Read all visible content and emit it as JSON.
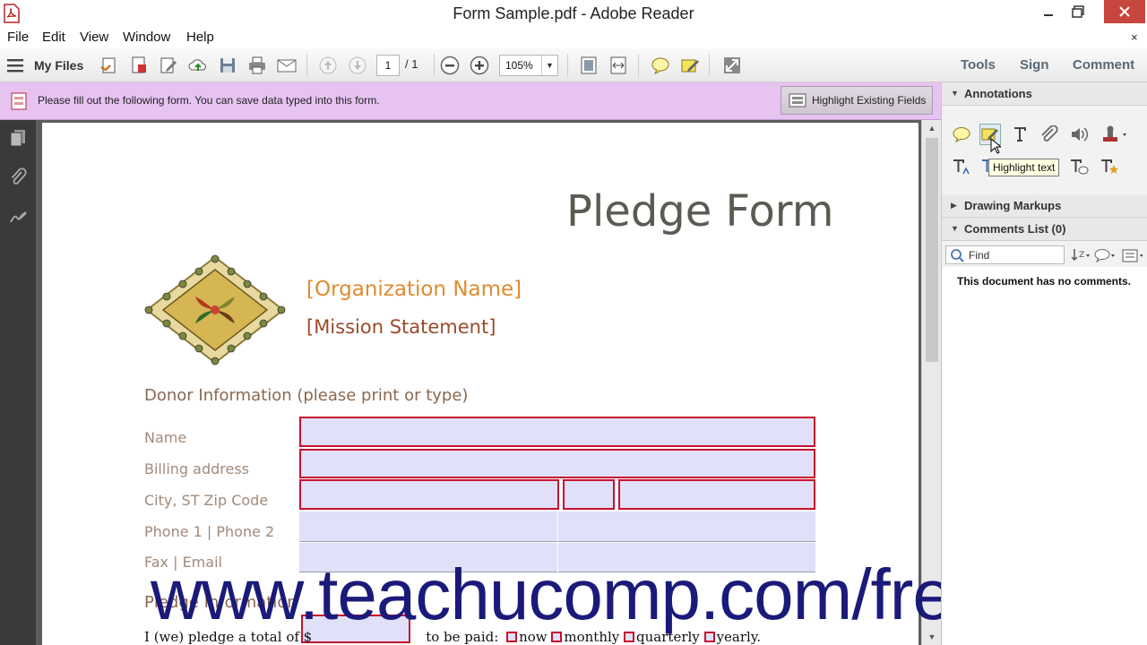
{
  "window": {
    "title": "Form Sample.pdf - Adobe Reader"
  },
  "menu": {
    "items": [
      "File",
      "Edit",
      "View",
      "Window",
      "Help"
    ],
    "close_document": "×"
  },
  "toolbar": {
    "my_files": "My Files",
    "page_current": "1",
    "page_total": "/ 1",
    "zoom": "105%",
    "pane_tabs": [
      "Tools",
      "Sign",
      "Comment"
    ]
  },
  "form_bar": {
    "message": "Please fill out the following form. You can save data typed into this form.",
    "highlight_button": "Highlight Existing Fields"
  },
  "document": {
    "title": "Pledge Form",
    "org_name": "[Organization Name]",
    "mission": "[Mission Statement]",
    "donor_heading": "Donor Information (please print or type)",
    "fields": {
      "name": "Name",
      "billing": "Billing address",
      "city": "City, ST  Zip Code",
      "phone": "Phone 1 | Phone 2",
      "fax": "Fax | Email"
    },
    "pledge_heading": "Pledge Information",
    "pledge_text_1": "I (we) pledge a total of $",
    "pledge_text_2": "to be paid:",
    "options": [
      "now",
      "monthly",
      "quarterly",
      "yearly."
    ]
  },
  "watermark": "www.teachucomp.com/free",
  "comment_pane": {
    "annotations": "Annotations",
    "tooltip": "Highlight text",
    "drawing_markups": "Drawing Markups",
    "comments_list": "Comments List (0)",
    "find_placeholder": "Find",
    "empty_message": "This document has no comments."
  },
  "colors": {
    "form_bar": "#e7c3f2",
    "field_fill": "#e0e0f9",
    "required_border": "#c8102e",
    "org_name": "#e08b2f",
    "watermark": "#1a1a7a"
  }
}
